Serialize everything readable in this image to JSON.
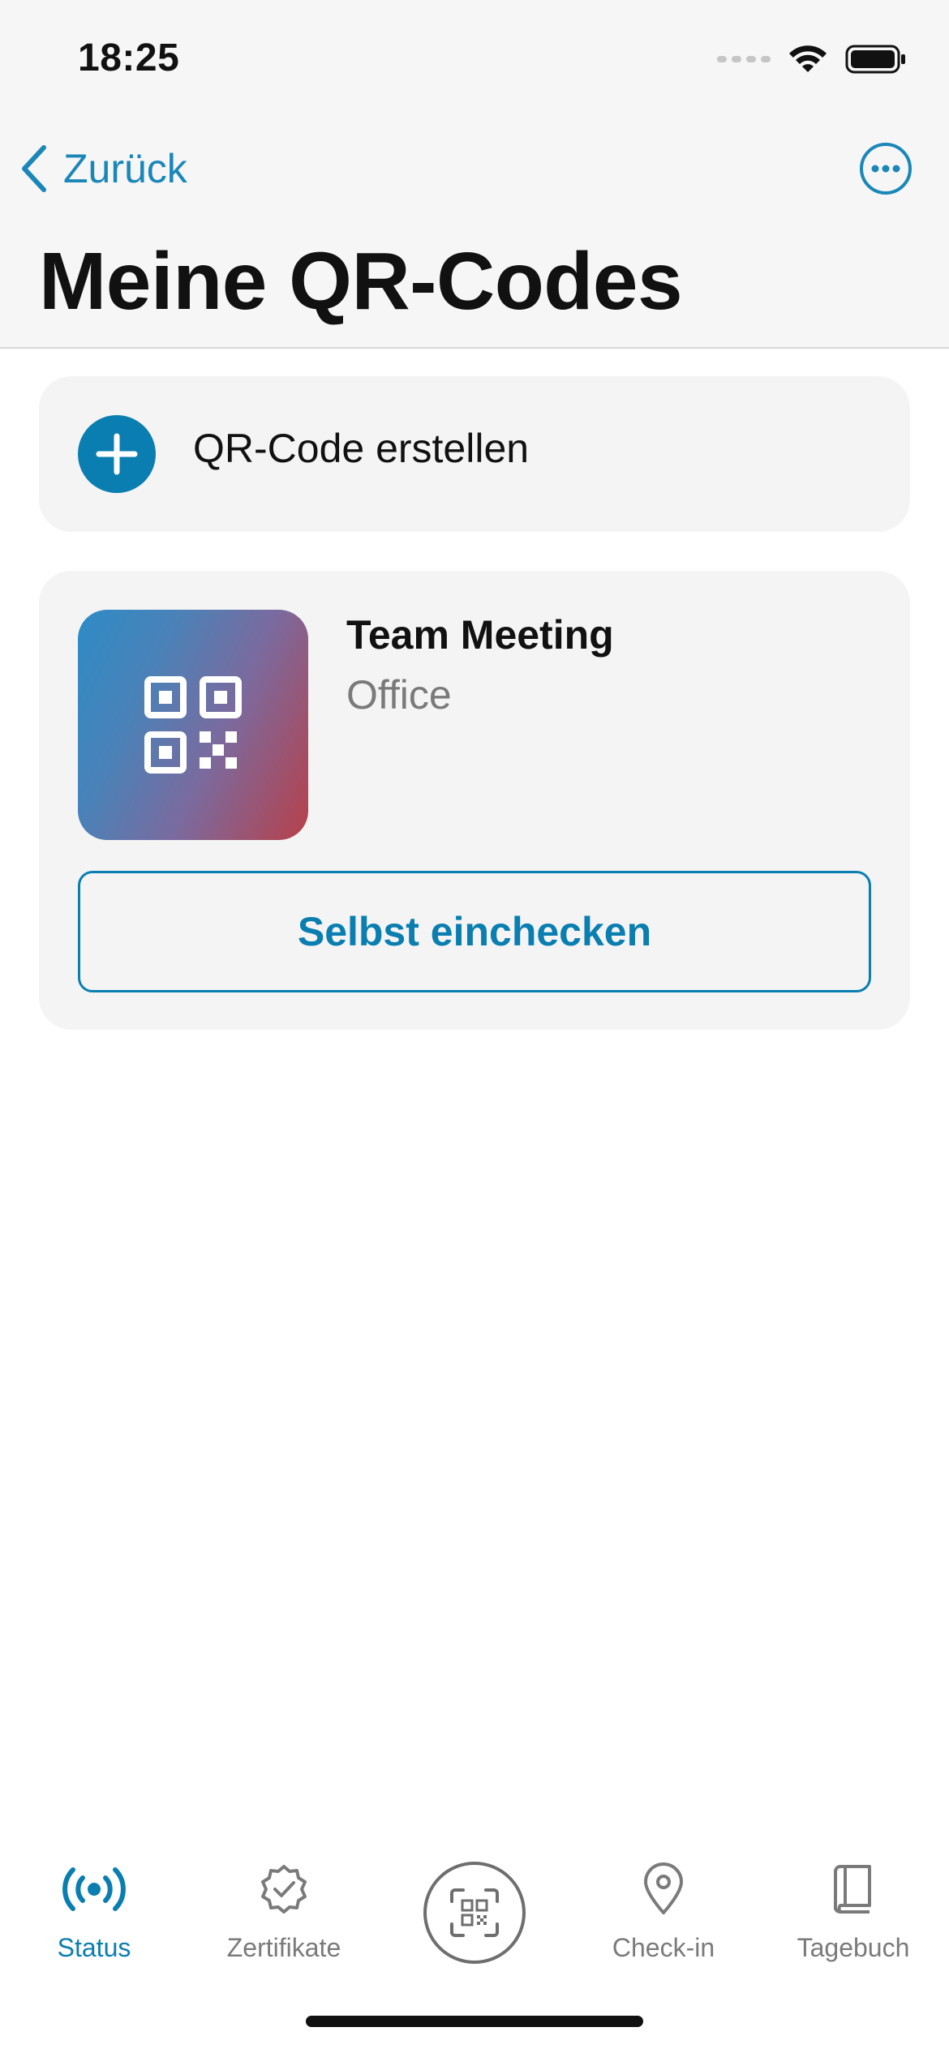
{
  "status_bar": {
    "time": "18:25"
  },
  "nav": {
    "back_label": "Zurück",
    "title": "Meine QR-Codes"
  },
  "create_card": {
    "label": "QR-Code erstellen"
  },
  "events": [
    {
      "title": "Team Meeting",
      "subtitle": "Office",
      "action_label": "Selbst einchecken"
    }
  ],
  "tabbar": {
    "items": [
      {
        "label": "Status",
        "icon": "broadcast-icon",
        "active": true
      },
      {
        "label": "Zertifikate",
        "icon": "certificate-badge-icon",
        "active": false
      },
      {
        "label": "",
        "icon": "qr-scan-icon",
        "active": false
      },
      {
        "label": "Check-in",
        "icon": "location-pin-icon",
        "active": false
      },
      {
        "label": "Tagebuch",
        "icon": "book-icon",
        "active": false
      }
    ]
  },
  "colors": {
    "accent": "#0a7eb0",
    "header_bg": "#f6f6f6",
    "card_bg": "#f4f4f4"
  }
}
